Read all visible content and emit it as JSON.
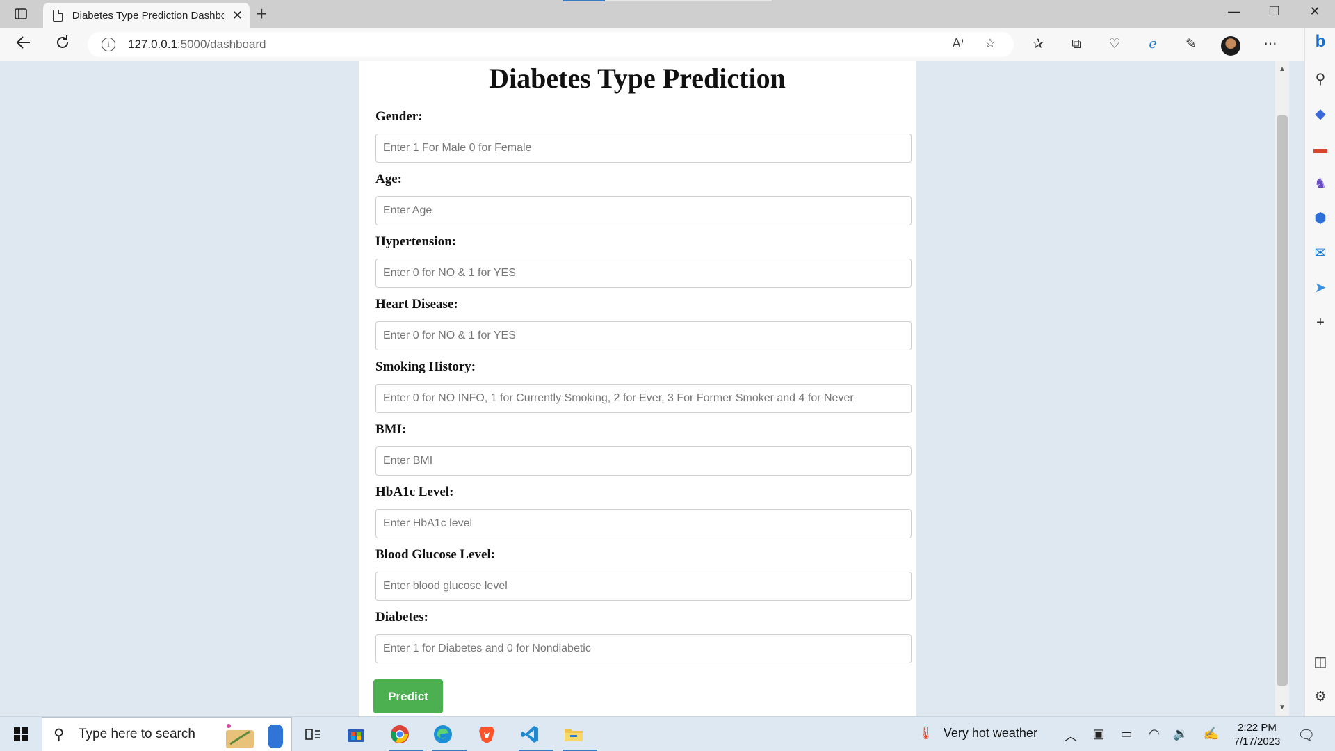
{
  "browser": {
    "tab_title": "Diabetes Type Prediction Dashbo",
    "url_host": "127.0.0.1",
    "url_path": ":5000/dashboard",
    "read_aloud_label": "A⁾"
  },
  "page": {
    "title": "Diabetes Type Prediction",
    "fields": [
      {
        "label": "Gender:",
        "placeholder": "Enter 1 For Male 0 for Female"
      },
      {
        "label": "Age:",
        "placeholder": "Enter Age"
      },
      {
        "label": "Hypertension:",
        "placeholder": "Enter 0 for NO & 1 for YES"
      },
      {
        "label": "Heart Disease:",
        "placeholder": "Enter 0 for NO & 1 for YES"
      },
      {
        "label": "Smoking History:",
        "placeholder": "Enter 0 for NO INFO, 1 for Currently Smoking, 2 for Ever, 3 For Former Smoker and 4 for Never"
      },
      {
        "label": "BMI:",
        "placeholder": "Enter BMI"
      },
      {
        "label": "HbA1c Level:",
        "placeholder": "Enter HbA1c level"
      },
      {
        "label": "Blood Glucose Level:",
        "placeholder": "Enter blood glucose level"
      },
      {
        "label": "Diabetes:",
        "placeholder": "Enter 1 for Diabetes and 0 for Nondiabetic"
      }
    ],
    "submit_label": "Predict"
  },
  "taskbar": {
    "search_placeholder": "Type here to search",
    "weather": "Very hot weather",
    "time": "2:22 PM",
    "date": "7/17/2023"
  },
  "icons": {
    "back": "back-arrow-icon",
    "refresh": "refresh-icon",
    "favorites": "star-icon",
    "bing": "bing-icon"
  },
  "colors": {
    "predict_button": "#4caf50",
    "page_background": "#dfe8f0",
    "card_background": "#ffffff"
  }
}
